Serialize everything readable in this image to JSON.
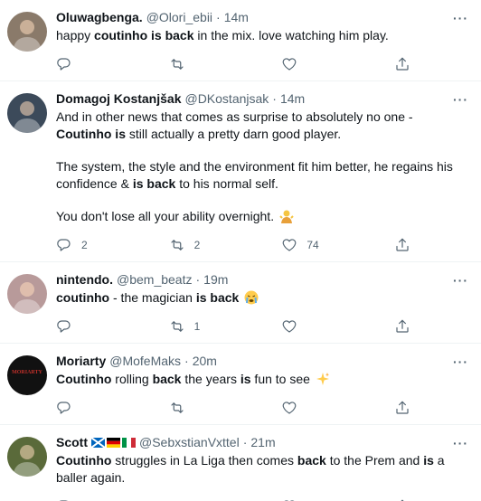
{
  "tweets": [
    {
      "name": "Oluwagbenga.",
      "handle": "@Olori_ebii",
      "sep": "·",
      "time": "14m",
      "avatar_color": "#8a7a6a",
      "segments": [
        [
          [
            "happy ",
            false
          ],
          [
            "coutinho is back",
            true
          ],
          [
            " in the mix. love watching him play.",
            false
          ]
        ]
      ],
      "counts": {
        "reply": "",
        "retweet": "",
        "like": ""
      }
    },
    {
      "name": "Domagoj Kostanjšak",
      "handle": "@DKostanjsak",
      "sep": "·",
      "time": "14m",
      "avatar_color": "#3c4a5a",
      "segments": [
        [
          [
            "And in other news that comes as surprise to absolutely no one - ",
            false
          ],
          [
            "Coutinho is",
            true
          ],
          [
            " still actually a pretty darn good player.",
            false
          ]
        ],
        [
          [
            "The system, the style and the environment fit him better, he regains his confidence & ",
            false
          ],
          [
            "is back",
            true
          ],
          [
            " to his normal self.",
            false
          ]
        ],
        [
          [
            "You don't lose all your ability overnight. ",
            false
          ]
        ]
      ],
      "emoji": "man-shrugging",
      "counts": {
        "reply": "2",
        "retweet": "2",
        "like": "74"
      }
    },
    {
      "name": "nintendo.",
      "handle": "@bem_beatz",
      "sep": "·",
      "time": "19m",
      "avatar_color": "#b89a9a",
      "segments": [
        [
          [
            "coutinho",
            true
          ],
          [
            " - the magician ",
            false
          ],
          [
            "is back",
            true
          ],
          [
            " ",
            false
          ]
        ]
      ],
      "emoji": "crying-face",
      "counts": {
        "reply": "",
        "retweet": "1",
        "like": ""
      }
    },
    {
      "name": "Moriarty",
      "handle": "@MofeMaks",
      "sep": "·",
      "time": "20m",
      "avatar_color": "#111111",
      "avatar_text": "MORIARTY",
      "segments": [
        [
          [
            "Coutinho",
            true
          ],
          [
            " rolling ",
            false
          ],
          [
            "back",
            true
          ],
          [
            " the years ",
            false
          ],
          [
            "is",
            true
          ],
          [
            " fun to see ",
            false
          ]
        ]
      ],
      "emoji": "sparkles",
      "counts": {
        "reply": "",
        "retweet": "",
        "like": ""
      }
    },
    {
      "name": "Scott",
      "flags": [
        "scotland",
        "germany",
        "italy"
      ],
      "handle": "@SebxstianVxttel",
      "sep": "·",
      "time": "21m",
      "avatar_color": "#5a6a3a",
      "segments": [
        [
          [
            "Coutinho",
            true
          ],
          [
            " struggles in La Liga then comes ",
            false
          ],
          [
            "back",
            true
          ],
          [
            " to the Prem and ",
            false
          ],
          [
            "is",
            true
          ],
          [
            " a baller again.",
            false
          ]
        ]
      ],
      "counts": {
        "reply": "",
        "retweet": "",
        "like": ""
      }
    }
  ],
  "colors": {
    "text": "#0f1419",
    "secondary": "#536471",
    "border": "#eff3f4"
  }
}
